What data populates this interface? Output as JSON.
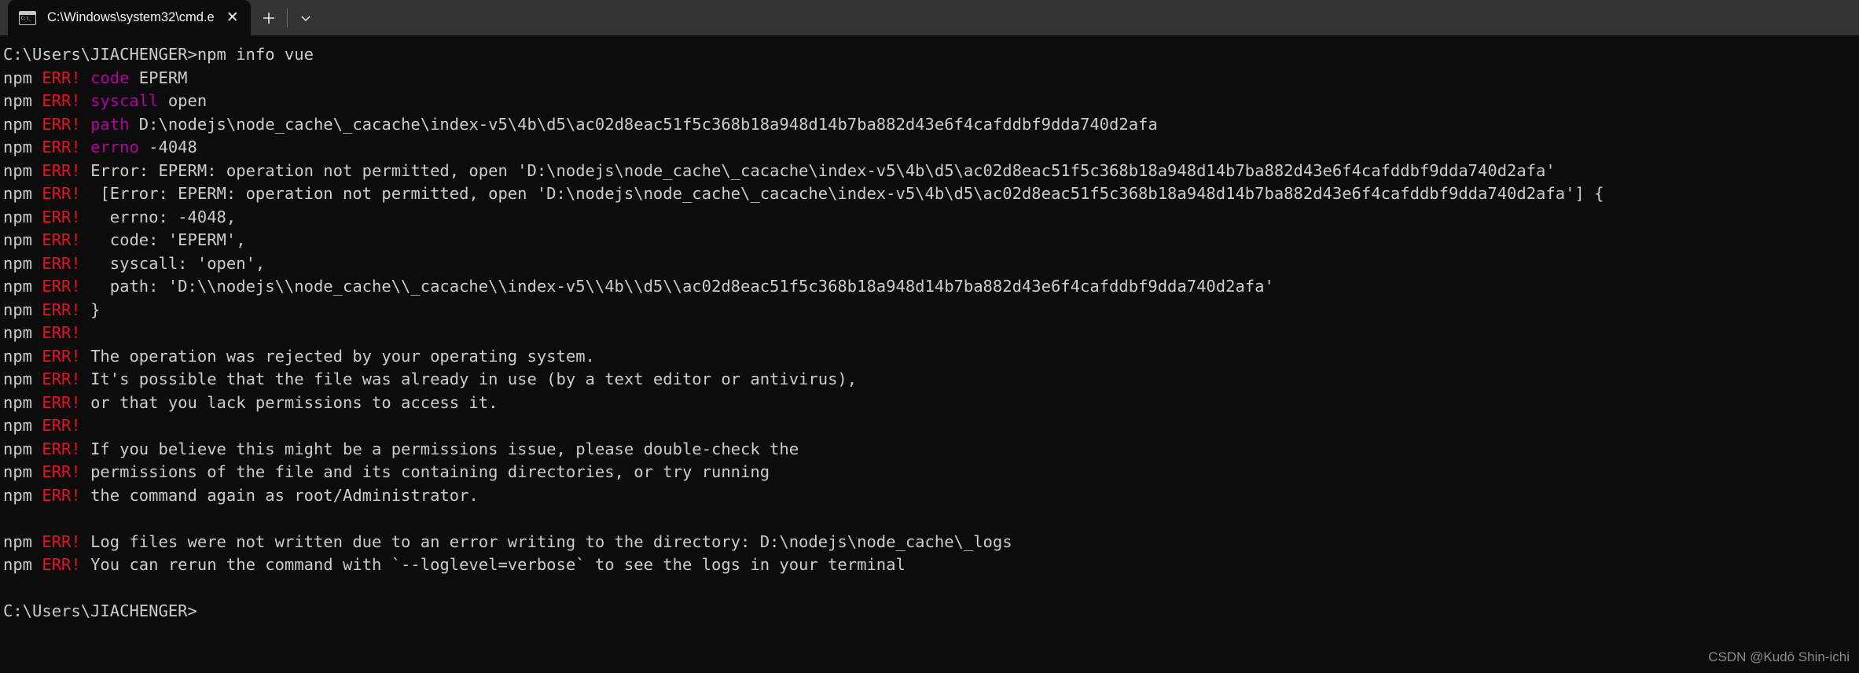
{
  "window": {
    "tab": {
      "icon": "cmd-console-icon",
      "title": "C:\\Windows\\system32\\cmd.e",
      "close_label": "✕"
    },
    "actions": {
      "new_tab_label": "+",
      "dropdown_label": "⌄"
    }
  },
  "terminal": {
    "prompt_path": "C:\\Users\\JIACHENGER",
    "command": "npm info vue",
    "prefix": "npm ",
    "err_tag": "ERR!",
    "lines": [
      {
        "type": "prompt",
        "text": "C:\\Users\\JIACHENGER>npm info vue"
      },
      {
        "type": "err",
        "key": " code",
        "rest": " EPERM"
      },
      {
        "type": "err",
        "key": " syscall",
        "rest": " open"
      },
      {
        "type": "err",
        "key": " path",
        "rest": " D:\\nodejs\\node_cache\\_cacache\\index-v5\\4b\\d5\\ac02d8eac51f5c368b18a948d14b7ba882d43e6f4cafddbf9dda740d2afa"
      },
      {
        "type": "err",
        "key": " errno",
        "rest": " -4048"
      },
      {
        "type": "err",
        "key": "",
        "rest": " Error: EPERM: operation not permitted, open 'D:\\nodejs\\node_cache\\_cacache\\index-v5\\4b\\d5\\ac02d8eac51f5c368b18a948d14b7ba882d43e6f4cafddbf9dda740d2afa'"
      },
      {
        "type": "err",
        "key": "",
        "rest": "  [Error: EPERM: operation not permitted, open 'D:\\nodejs\\node_cache\\_cacache\\index-v5\\4b\\d5\\ac02d8eac51f5c368b18a948d14b7ba882d43e6f4cafddbf9dda740d2afa'] {"
      },
      {
        "type": "err",
        "key": "",
        "rest": "   errno: -4048,"
      },
      {
        "type": "err",
        "key": "",
        "rest": "   code: 'EPERM',"
      },
      {
        "type": "err",
        "key": "",
        "rest": "   syscall: 'open',"
      },
      {
        "type": "err",
        "key": "",
        "rest": "   path: 'D:\\\\nodejs\\\\node_cache\\\\_cacache\\\\index-v5\\\\4b\\\\d5\\\\ac02d8eac51f5c368b18a948d14b7ba882d43e6f4cafddbf9dda740d2afa'"
      },
      {
        "type": "err",
        "key": "",
        "rest": " }"
      },
      {
        "type": "err",
        "key": "",
        "rest": ""
      },
      {
        "type": "err",
        "key": "",
        "rest": " The operation was rejected by your operating system."
      },
      {
        "type": "err",
        "key": "",
        "rest": " It's possible that the file was already in use (by a text editor or antivirus),"
      },
      {
        "type": "err",
        "key": "",
        "rest": " or that you lack permissions to access it."
      },
      {
        "type": "err",
        "key": "",
        "rest": ""
      },
      {
        "type": "err",
        "key": "",
        "rest": " If you believe this might be a permissions issue, please double-check the"
      },
      {
        "type": "err",
        "key": "",
        "rest": " permissions of the file and its containing directories, or try running"
      },
      {
        "type": "err",
        "key": "",
        "rest": " the command again as root/Administrator."
      },
      {
        "type": "blank",
        "text": ""
      },
      {
        "type": "err",
        "key": "",
        "rest": " Log files were not written due to an error writing to the directory: D:\\nodejs\\node_cache\\_logs"
      },
      {
        "type": "err",
        "key": "",
        "rest": " You can rerun the command with `--loglevel=verbose` to see the logs in your terminal"
      },
      {
        "type": "blank",
        "text": ""
      },
      {
        "type": "prompt",
        "text": "C:\\Users\\JIACHENGER>"
      }
    ]
  },
  "watermark": {
    "text": "CSDN @Kudō Shin-ichi"
  },
  "colors": {
    "terminal_bg": "#0c0c0c",
    "titlebar_bg": "#333333",
    "text": "#cccccc",
    "error": "#e81123",
    "key": "#b4009e"
  }
}
